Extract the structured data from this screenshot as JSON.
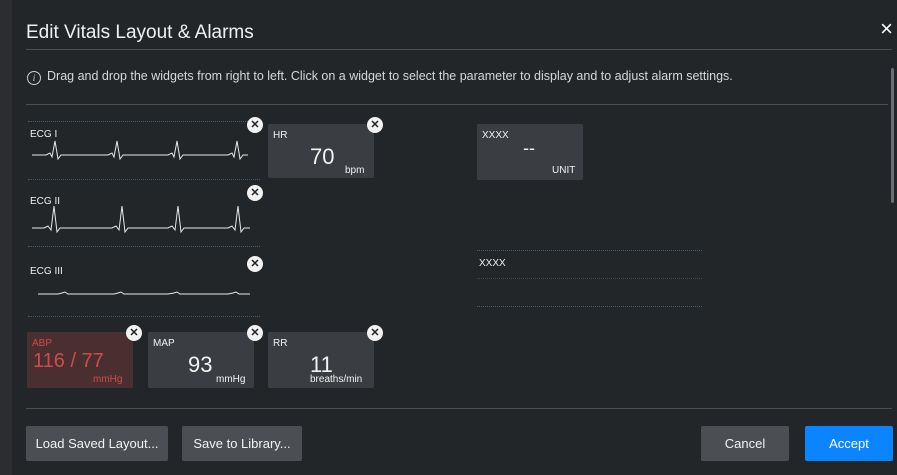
{
  "dialog": {
    "title": "Edit Vitals Layout & Alarms",
    "close_icon": "×",
    "info_icon": "i",
    "info_text": "Drag and drop the widgets from right to left. Click on a widget to select the parameter to display and to adjust alarm settings."
  },
  "waveforms": [
    {
      "label": "ECG I"
    },
    {
      "label": "ECG II"
    },
    {
      "label": "ECG III"
    }
  ],
  "tiles": {
    "hr": {
      "name": "HR",
      "value": "70",
      "unit": "bpm"
    },
    "abp": {
      "name": "ABP",
      "value": "116 / 77",
      "unit": "mmHg"
    },
    "map": {
      "name": "MAP",
      "value": "93",
      "unit": "mmHg"
    },
    "rr": {
      "name": "RR",
      "value": "11",
      "unit": "breaths/min"
    }
  },
  "library": {
    "numeric": {
      "name": "XXXX",
      "value": "--",
      "unit": "UNIT"
    },
    "waveform": {
      "name": "XXXX"
    }
  },
  "remove_icon": "✕",
  "buttons": {
    "load": "Load Saved Layout...",
    "save": "Save to Library...",
    "cancel": "Cancel",
    "accept": "Accept"
  },
  "colors": {
    "accent": "#0a84ff",
    "alarm": "#d14a4a"
  }
}
